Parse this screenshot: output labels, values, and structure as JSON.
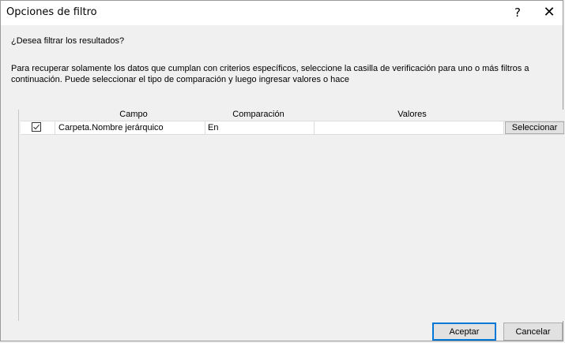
{
  "window": {
    "title": "Opciones de filtro",
    "help_glyph": "?",
    "close_glyph": "✕"
  },
  "prompt": {
    "question": "¿Desea filtrar los resultados?",
    "instructions": "Para recuperar solamente los datos que cumplan con criterios específicos, seleccione la casilla de verificación para uno o más filtros a continuación. Puede seleccionar el tipo de comparación y luego ingresar valores o hace"
  },
  "grid": {
    "columns": {
      "campo": "Campo",
      "comparacion": "Comparación",
      "valores": "Valores"
    },
    "rows": [
      {
        "checked": true,
        "campo": "Carpeta.Nombre jerárquico",
        "comparacion": "En",
        "valores": "",
        "select_label": "Seleccionar"
      }
    ]
  },
  "footer": {
    "ok_label": "Aceptar",
    "cancel_label": "Cancelar"
  },
  "colors": {
    "accent": "#0078d7",
    "background": "#f0f0f0"
  }
}
